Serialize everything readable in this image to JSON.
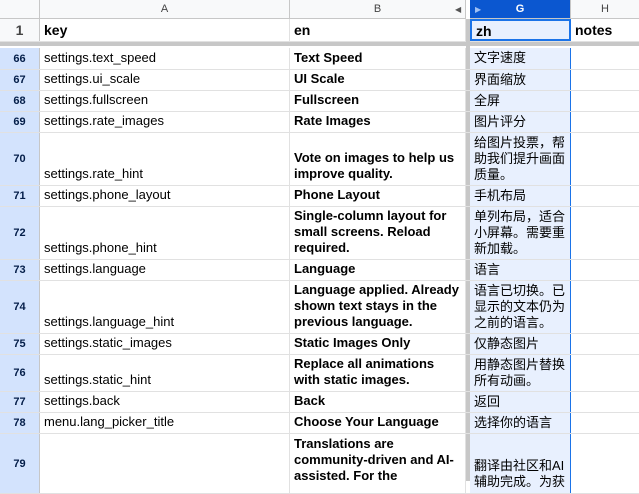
{
  "columns": {
    "a": "A",
    "b": "B",
    "g": "G",
    "h": "H"
  },
  "header_row": {
    "num": "1",
    "key": "key",
    "en": "en",
    "zh": "zh",
    "notes": "notes"
  },
  "rows": [
    {
      "num": "66",
      "key": "settings.text_speed",
      "en": "Text Speed",
      "zh": "文字速度"
    },
    {
      "num": "67",
      "key": "settings.ui_scale",
      "en": "UI Scale",
      "zh": "界面缩放"
    },
    {
      "num": "68",
      "key": "settings.fullscreen",
      "en": "Fullscreen",
      "zh": "全屏"
    },
    {
      "num": "69",
      "key": "settings.rate_images",
      "en": "Rate Images",
      "zh": "图片评分"
    },
    {
      "num": "70",
      "key": "settings.rate_hint",
      "en": "Vote on images to help us improve quality.",
      "zh": "给图片投票，帮助我们提升画面质量。"
    },
    {
      "num": "71",
      "key": "settings.phone_layout",
      "en": "Phone Layout",
      "zh": "手机布局"
    },
    {
      "num": "72",
      "key": "settings.phone_hint",
      "en": "Single-column layout for small screens. Reload required.",
      "zh": "单列布局，适合小屏幕。需要重新加载。"
    },
    {
      "num": "73",
      "key": "settings.language",
      "en": "Language",
      "zh": "语言"
    },
    {
      "num": "74",
      "key": "settings.language_hint",
      "en": "Language applied. Already shown text stays in the previous language.",
      "zh": "语言已切换。已显示的文本仍为之前的语言。"
    },
    {
      "num": "75",
      "key": "settings.static_images",
      "en": "Static Images Only",
      "zh": "仅静态图片"
    },
    {
      "num": "76",
      "key": "settings.static_hint",
      "en": "Replace all animations with static images.",
      "zh": "用静态图片替换所有动画。"
    },
    {
      "num": "77",
      "key": "settings.back",
      "en": "Back",
      "zh": "返回"
    },
    {
      "num": "78",
      "key": "menu.lang_picker_title",
      "en": "Choose Your Language",
      "zh": "选择你的语言"
    },
    {
      "num": "79",
      "key": "",
      "en": "Translations are community-driven and AI-assisted. For the",
      "zh": "翻译由社区和AI辅助完成。为获"
    }
  ]
}
